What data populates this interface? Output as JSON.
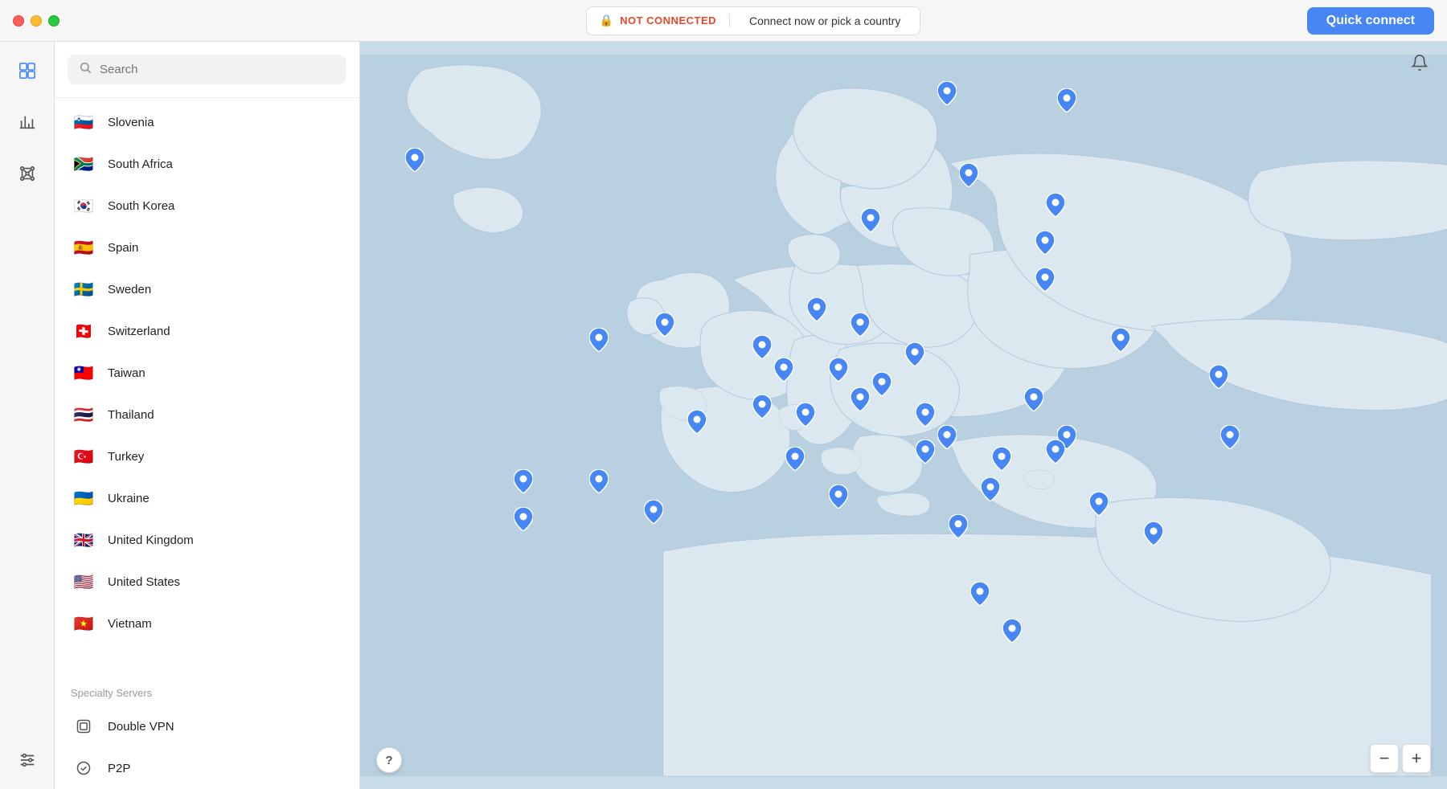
{
  "titlebar": {
    "quick_connect_label": "Quick connect",
    "not_connected_label": "NOT CONNECTED",
    "connect_hint": "Connect now or pick a country"
  },
  "search": {
    "placeholder": "Search"
  },
  "countries": [
    {
      "id": "slovenia",
      "name": "Slovenia",
      "flag": "🇸🇮"
    },
    {
      "id": "south-africa",
      "name": "South Africa",
      "flag": "🇿🇦"
    },
    {
      "id": "south-korea",
      "name": "South Korea",
      "flag": "🇰🇷"
    },
    {
      "id": "spain",
      "name": "Spain",
      "flag": "🇪🇸"
    },
    {
      "id": "sweden",
      "name": "Sweden",
      "flag": "🇸🇪"
    },
    {
      "id": "switzerland",
      "name": "Switzerland",
      "flag": "🇨🇭"
    },
    {
      "id": "taiwan",
      "name": "Taiwan",
      "flag": "🇹🇼"
    },
    {
      "id": "thailand",
      "name": "Thailand",
      "flag": "🇹🇭"
    },
    {
      "id": "turkey",
      "name": "Turkey",
      "flag": "🇹🇷"
    },
    {
      "id": "ukraine",
      "name": "Ukraine",
      "flag": "🇺🇦"
    },
    {
      "id": "united-kingdom",
      "name": "United Kingdom",
      "flag": "🇬🇧"
    },
    {
      "id": "united-states",
      "name": "United States",
      "flag": "🇺🇸"
    },
    {
      "id": "vietnam",
      "name": "Vietnam",
      "flag": "🇻🇳"
    }
  ],
  "specialty": {
    "section_label": "Specialty Servers",
    "items": [
      {
        "id": "double-vpn",
        "name": "Double VPN",
        "icon": "⊡"
      },
      {
        "id": "p2p",
        "name": "P2P",
        "icon": "⊙"
      }
    ]
  },
  "sidebar_icons": [
    {
      "id": "layers",
      "icon": "◈",
      "label": "Servers"
    },
    {
      "id": "stats",
      "icon": "▐",
      "label": "Statistics"
    },
    {
      "id": "mesh",
      "icon": "⊹",
      "label": "Meshnet"
    },
    {
      "id": "settings",
      "icon": "⚙",
      "label": "Settings"
    }
  ],
  "map": {
    "question_label": "?",
    "zoom_in_label": "−",
    "zoom_out_label": "+"
  },
  "map_pins": [
    {
      "id": "pin-iceland",
      "top": "15",
      "left": "4"
    },
    {
      "id": "pin-norway",
      "top": "8",
      "left": "52"
    },
    {
      "id": "pin-finland",
      "top": "10",
      "left": "64"
    },
    {
      "id": "pin-sweden-n",
      "top": "18",
      "left": "56"
    },
    {
      "id": "pin-norway2",
      "top": "28",
      "left": "48"
    },
    {
      "id": "pin-estonia",
      "top": "25",
      "left": "65"
    },
    {
      "id": "pin-latvia",
      "top": "30",
      "left": "64"
    },
    {
      "id": "pin-uk-w",
      "top": "40",
      "left": "20"
    },
    {
      "id": "pin-uk-e",
      "top": "40",
      "left": "27"
    },
    {
      "id": "pin-netherlands",
      "top": "42",
      "left": "37"
    },
    {
      "id": "pin-denmark",
      "top": "38",
      "left": "43"
    },
    {
      "id": "pin-germany-w",
      "top": "44",
      "left": "39"
    },
    {
      "id": "pin-germany-c",
      "top": "47",
      "left": "43"
    },
    {
      "id": "pin-poland",
      "top": "44",
      "left": "52"
    },
    {
      "id": "pin-germany-e",
      "top": "41",
      "left": "46"
    },
    {
      "id": "pin-russia-w",
      "top": "35",
      "left": "64"
    },
    {
      "id": "pin-russia-c",
      "top": "42",
      "left": "70"
    },
    {
      "id": "pin-france-w",
      "top": "52",
      "left": "30"
    },
    {
      "id": "pin-france-c",
      "top": "52",
      "left": "36"
    },
    {
      "id": "pin-switzerland2",
      "top": "52",
      "left": "41"
    },
    {
      "id": "pin-austria",
      "top": "52",
      "left": "46"
    },
    {
      "id": "pin-czech",
      "top": "49",
      "left": "49"
    },
    {
      "id": "pin-slovakia",
      "top": "52",
      "left": "53"
    },
    {
      "id": "pin-hungary",
      "top": "55",
      "left": "55"
    },
    {
      "id": "pin-ukraine2",
      "top": "50",
      "left": "62"
    },
    {
      "id": "pin-ukraine3",
      "top": "55",
      "left": "66"
    },
    {
      "id": "pin-romania",
      "top": "58",
      "left": "60"
    },
    {
      "id": "pin-moldova",
      "top": "58",
      "left": "64"
    },
    {
      "id": "pin-spain-n",
      "top": "60",
      "left": "22"
    },
    {
      "id": "pin-spain-s",
      "top": "63",
      "left": "27"
    },
    {
      "id": "pin-italy-n",
      "top": "56",
      "left": "40"
    },
    {
      "id": "pin-italy-s",
      "top": "62",
      "left": "43"
    },
    {
      "id": "pin-serbia",
      "top": "58",
      "left": "53"
    },
    {
      "id": "pin-bulgaria",
      "top": "62",
      "left": "58"
    },
    {
      "id": "pin-greece",
      "top": "67",
      "left": "57"
    },
    {
      "id": "pin-turkey2",
      "top": "65",
      "left": "67"
    },
    {
      "id": "pin-russia-e",
      "top": "47",
      "left": "80"
    },
    {
      "id": "pin-kazakhstan",
      "top": "55",
      "left": "80"
    },
    {
      "id": "pin-portugal",
      "top": "60",
      "left": "14"
    },
    {
      "id": "pin-portugal2",
      "top": "65",
      "left": "14"
    },
    {
      "id": "pin-turkey3",
      "top": "68",
      "left": "73"
    },
    {
      "id": "pin-bottom1",
      "top": "76",
      "left": "56"
    },
    {
      "id": "pin-bottom2",
      "top": "80",
      "left": "60"
    }
  ]
}
